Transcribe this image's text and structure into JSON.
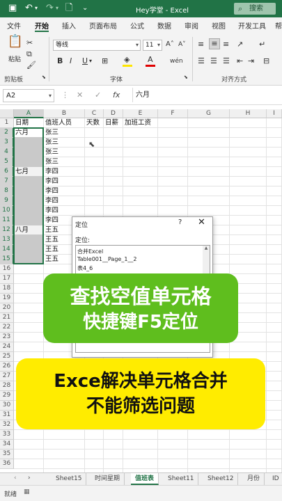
{
  "titlebar": {
    "title": "Hey学堂  -  Excel",
    "search": "搜索",
    "icons": [
      "save-icon",
      "undo-icon",
      "redo-icon",
      "new-file-icon",
      "more-icon"
    ]
  },
  "menu": {
    "tabs": [
      "文件",
      "开始",
      "插入",
      "页面布局",
      "公式",
      "数据",
      "审阅",
      "视图",
      "开发工具",
      "帮"
    ],
    "active": "开始"
  },
  "ribbon": {
    "clipboard_label": "剪贴板",
    "paste_label": "粘贴",
    "font_name": "等线",
    "font_size": "11",
    "bold": "B",
    "italic": "I",
    "underline": "U",
    "font_label": "字体",
    "align_label": "对齐方式",
    "font_color": "#e00000",
    "fill_color": "#ffe600"
  },
  "formula_bar": {
    "name_box": "A2",
    "cancel": "✕",
    "confirm": "✓",
    "fx": "fx",
    "value": "六月"
  },
  "grid": {
    "columns": [
      "A",
      "B",
      "C",
      "D",
      "E",
      "F",
      "G",
      "H",
      "I"
    ],
    "rows": [
      "1",
      "2",
      "3",
      "4",
      "5",
      "6",
      "7",
      "8",
      "9",
      "10",
      "11",
      "12",
      "13",
      "14",
      "15",
      "16",
      "17",
      "18",
      "19",
      "20",
      "21",
      "22",
      "23",
      "24",
      "25",
      "26",
      "27",
      "28",
      "29",
      "30",
      "31",
      "32",
      "33",
      "34",
      "35",
      "36"
    ],
    "headers": {
      "A": "日期",
      "B": "值班人员",
      "C": "天数",
      "D": "日薪",
      "E": "加班工资"
    },
    "col_a": {
      "2": "六月",
      "6": "七月",
      "12": "八月"
    },
    "col_b": [
      "张三",
      "张三",
      "张三",
      "张三",
      "李四",
      "李四",
      "李四",
      "李四",
      "李四",
      "李四",
      "王五",
      "王五",
      "王五",
      "王五"
    ]
  },
  "dialog": {
    "title": "定位",
    "help": "?",
    "close": "✕",
    "label": "定位:",
    "items": [
      "合并Excel",
      "Table001__Page_1__2",
      "表4_6"
    ]
  },
  "overlay": {
    "green_line1": "查找空值单元格",
    "green_line2": "快捷键F5定位",
    "yellow_line1": "Exce解决单元格合并",
    "yellow_line2": "不能筛选问题"
  },
  "sheets": {
    "nav": "‹ ›",
    "tabs": [
      "Sheet15",
      "时间星期",
      "值班表",
      "Sheet11",
      "Sheet12",
      "月份",
      "ID"
    ],
    "active": "值班表"
  },
  "status": {
    "text": "就绪"
  }
}
